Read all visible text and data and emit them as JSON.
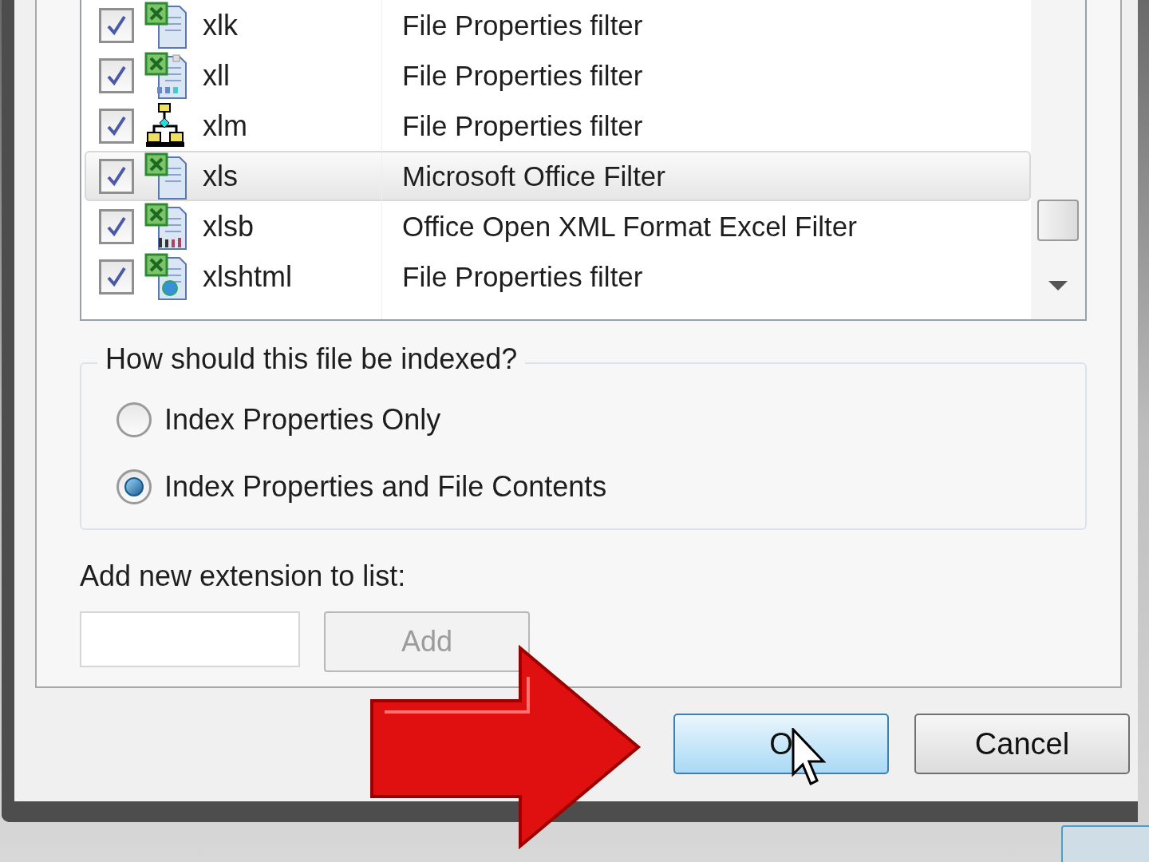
{
  "file_types": [
    {
      "extension": "xlk",
      "filter": "File Properties filter",
      "checked": true,
      "selected": false,
      "kind": "sheet"
    },
    {
      "extension": "xll",
      "filter": "File Properties filter",
      "checked": true,
      "selected": false,
      "kind": "addin"
    },
    {
      "extension": "xlm",
      "filter": "File Properties filter",
      "checked": true,
      "selected": false,
      "kind": "diagram"
    },
    {
      "extension": "xls",
      "filter": "Microsoft Office Filter",
      "checked": true,
      "selected": true,
      "kind": "sheet"
    },
    {
      "extension": "xlsb",
      "filter": "Office Open XML Format Excel Filter",
      "checked": true,
      "selected": false,
      "kind": "binary"
    },
    {
      "extension": "xlshtml",
      "filter": "File Properties filter",
      "checked": true,
      "selected": false,
      "kind": "web"
    }
  ],
  "index_group": {
    "title": "How should this file be indexed?",
    "options": [
      {
        "label": "Index Properties Only",
        "selected": false
      },
      {
        "label": "Index Properties and File Contents",
        "selected": true
      }
    ]
  },
  "new_extension": {
    "label": "Add new extension to list:",
    "add_button": {
      "label": "Add",
      "disabled": true
    }
  },
  "buttons": [
    {
      "label": "O",
      "focused": true
    },
    {
      "label": "Cancel",
      "focused": false
    }
  ]
}
